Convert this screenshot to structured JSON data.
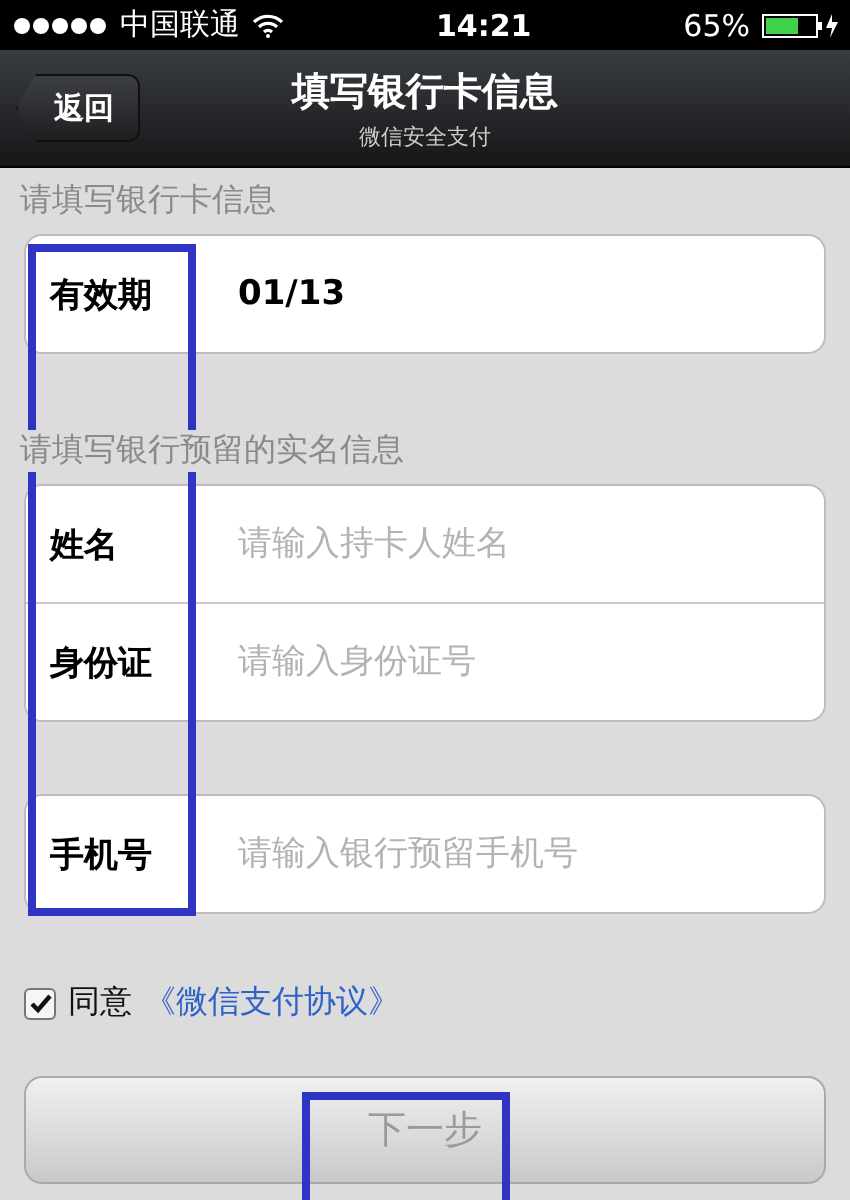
{
  "status_bar": {
    "carrier": "中国联通",
    "time": "14:21",
    "battery": "65%"
  },
  "nav_bar": {
    "back_button": "返回",
    "title": "填写银行卡信息",
    "subtitle": "微信安全支付"
  },
  "sections": [
    {
      "header": "请填写银行卡信息",
      "fields": [
        {
          "label": "有效期",
          "value": "01/13"
        }
      ]
    },
    {
      "header": "请填写银行预留的实名信息",
      "fields": [
        {
          "label": "姓名",
          "placeholder": "请输入持卡人姓名"
        },
        {
          "label": "身份证",
          "placeholder": "请输入身份证号"
        }
      ]
    },
    {
      "fields": [
        {
          "label": "手机号",
          "placeholder": "请输入银行预留手机号"
        }
      ]
    }
  ],
  "agreement": {
    "checked": true,
    "text": "同意",
    "link": "《微信支付协议》"
  },
  "next_button": {
    "label": "下一步",
    "disabled": true
  },
  "annotations": {
    "label_column_framed": true,
    "button_label_framed": true
  }
}
